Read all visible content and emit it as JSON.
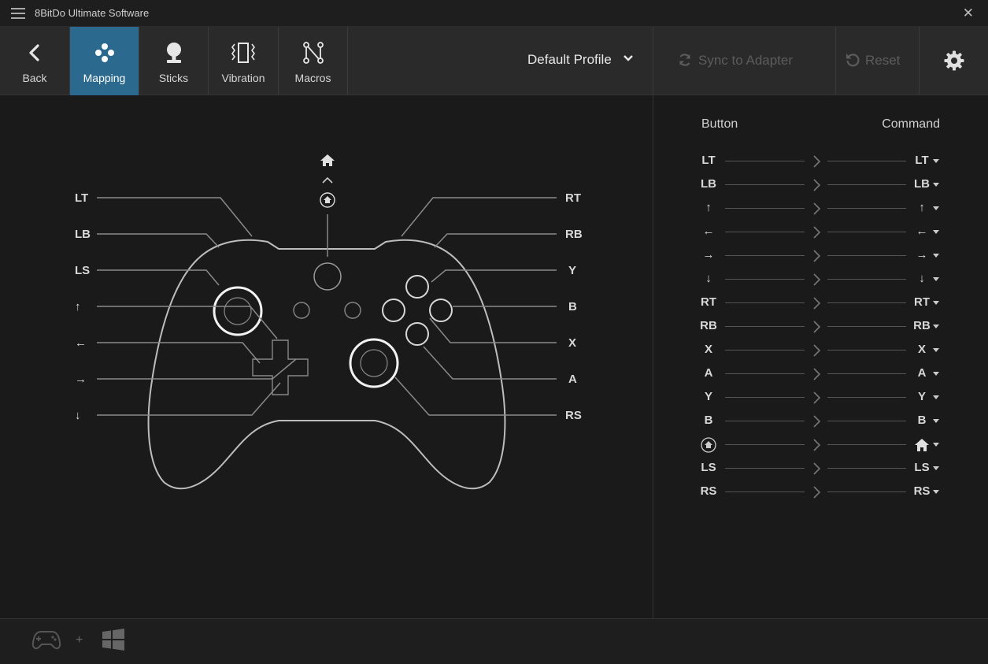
{
  "app": {
    "title": "8BitDo Ultimate Software"
  },
  "toolbar": {
    "tabs": [
      {
        "label": "Back",
        "icon": "chevron-left-icon"
      },
      {
        "label": "Mapping",
        "icon": "dots-icon",
        "active": true
      },
      {
        "label": "Sticks",
        "icon": "joystick-icon"
      },
      {
        "label": "Vibration",
        "icon": "vibration-icon"
      },
      {
        "label": "Macros",
        "icon": "macro-nodes-icon"
      }
    ],
    "profile": "Default Profile",
    "sync": "Sync to Adapter",
    "reset": "Reset"
  },
  "controller": {
    "left_labels": [
      "LT",
      "LB",
      "LS",
      "↑",
      "←",
      "→",
      "↓"
    ],
    "right_labels": [
      "RT",
      "RB",
      "Y",
      "B",
      "X",
      "A",
      "RS"
    ],
    "home_icon": "home-icon"
  },
  "mapping": {
    "header_button": "Button",
    "header_command": "Command",
    "rows": [
      {
        "button": "LT",
        "command": "LT"
      },
      {
        "button": "LB",
        "command": "LB"
      },
      {
        "button": "↑",
        "command": "↑"
      },
      {
        "button": "←",
        "command": "←"
      },
      {
        "button": "→",
        "command": "→"
      },
      {
        "button": "↓",
        "command": "↓"
      },
      {
        "button": "RT",
        "command": "RT"
      },
      {
        "button": "RB",
        "command": "RB"
      },
      {
        "button": "X",
        "command": "X"
      },
      {
        "button": "A",
        "command": "A"
      },
      {
        "button": "Y",
        "command": "Y"
      },
      {
        "button": "B",
        "command": "B"
      },
      {
        "button": "",
        "command": "",
        "icon": "home-icon"
      },
      {
        "button": "LS",
        "command": "LS"
      },
      {
        "button": "RS",
        "command": "RS"
      }
    ]
  },
  "bottom": {
    "plus": "+"
  }
}
